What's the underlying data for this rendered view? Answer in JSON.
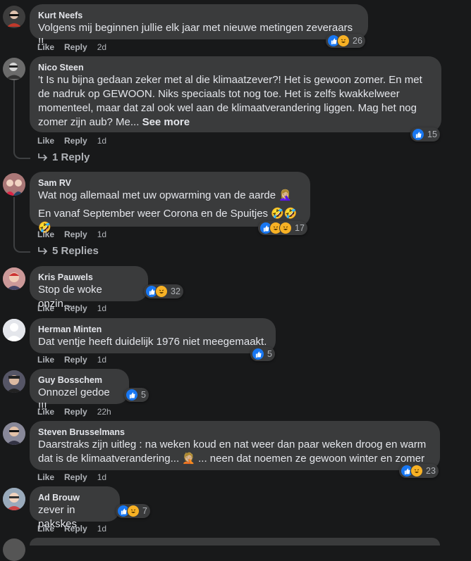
{
  "comments": [
    {
      "author": "Kurt Neefs",
      "text": "Volgens mij beginnen jullie elk jaar met nieuwe metingen zeveraars !!",
      "reactions": [
        "like",
        "haha"
      ],
      "reaction_count": "26",
      "like_label": "Like",
      "reply_label": "Reply",
      "time": "2d"
    },
    {
      "author": "Nico Steen",
      "text": "'t Is nu bijna gedaan zeker met al die klimaatzever?! Het is gewoon zomer. En met de nadruk op GEWOON. Niks speciaals tot nog toe. Het is zelfs kwakkelweer momenteel, maar dat zal ook wel aan de klimaatverandering liggen. Mag het nog zomer zijn aub? Me...",
      "see_more": "See more",
      "reactions": [
        "like"
      ],
      "reaction_count": "15",
      "like_label": "Like",
      "reply_label": "Reply",
      "time": "1d",
      "replies_label": "1 Reply"
    },
    {
      "author": "Sam RV",
      "text1": "Wat nog allemaal met uw opwarming van de aarde 🤦🏼‍♀️",
      "text2": "En vanaf September weer Corona en de Spuitjes 🤣🤣🤣",
      "reactions": [
        "like",
        "haha",
        "haha"
      ],
      "reaction_count": "17",
      "like_label": "Like",
      "reply_label": "Reply",
      "time": "1d",
      "replies_label": "5 Replies"
    },
    {
      "author": "Kris Pauwels",
      "text": "Stop de woke onzin.....",
      "reactions": [
        "like",
        "haha"
      ],
      "reaction_count": "32",
      "like_label": "Like",
      "reply_label": "Reply",
      "time": "1d"
    },
    {
      "author": "Herman Minten",
      "text": "Dat ventje heeft duidelijk 1976 niet meegemaakt.",
      "reactions": [
        "like"
      ],
      "reaction_count": "5",
      "like_label": "Like",
      "reply_label": "Reply",
      "time": "1d"
    },
    {
      "author": "Guy Bosschem",
      "text": "Onnozel gedoe !!!",
      "reactions": [
        "like"
      ],
      "reaction_count": "5",
      "like_label": "Like",
      "reply_label": "Reply",
      "time": "22h"
    },
    {
      "author": "Steven Brusselmans",
      "text": "Daarstraks zijn uitleg : na weken koud en nat weer dan paar weken droog en warm dat is de klimaatverandering... 🤦🏼 ... neen dat noemen ze gewoon winter en zomer",
      "reactions": [
        "like",
        "haha"
      ],
      "reaction_count": "23",
      "like_label": "Like",
      "reply_label": "Reply",
      "time": "1d"
    },
    {
      "author": "Ad Brouw",
      "text": "zever in pakskes",
      "reactions": [
        "like",
        "haha"
      ],
      "reaction_count": "7",
      "like_label": "Like",
      "reply_label": "Reply",
      "time": "1d"
    }
  ],
  "colors": {
    "background": "#18191a",
    "bubble": "#3a3b3c",
    "text": "#e4e6eb",
    "secondary": "#b0b3b8",
    "like_blue": "#1877f2",
    "haha_yellow": "#f7b125"
  },
  "icons": {
    "like": "thumbs-up-icon",
    "haha": "laughing-face-icon",
    "reply_arrow": "reply-arrow-icon"
  }
}
